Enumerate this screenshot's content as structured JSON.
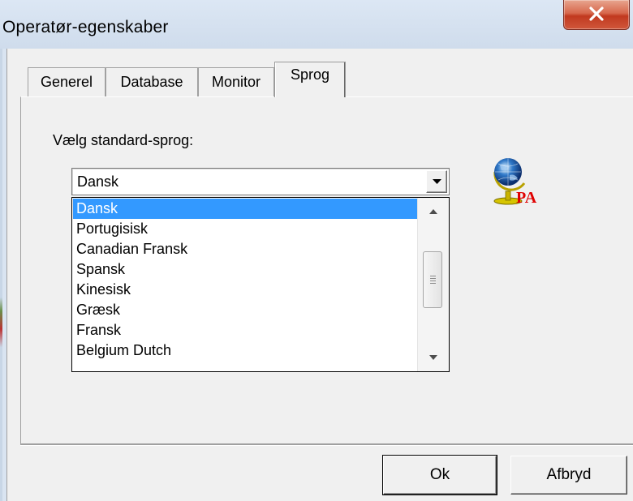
{
  "window": {
    "title": "Operatør-egenskaber",
    "close_label": "X"
  },
  "tabs": [
    {
      "label": "Generel",
      "active": false
    },
    {
      "label": "Database",
      "active": false
    },
    {
      "label": "Monitor",
      "active": false
    },
    {
      "label": "Sprog",
      "active": true
    }
  ],
  "language_panel": {
    "label": "Vælg standard-sprog:",
    "selected_value": "Dansk",
    "options": [
      "Dansk",
      "Portugisisk",
      "Canadian Fransk",
      "Spansk",
      "Kinesisk",
      "Græsk",
      "Fransk",
      "Belgium Dutch"
    ],
    "highlighted_index": 0,
    "logo_icon": "globe-icon"
  },
  "buttons": {
    "ok_label": "Ok",
    "cancel_label": "Afbryd"
  },
  "colors": {
    "selection": "#3399ff",
    "close_button": "#c1391f"
  }
}
